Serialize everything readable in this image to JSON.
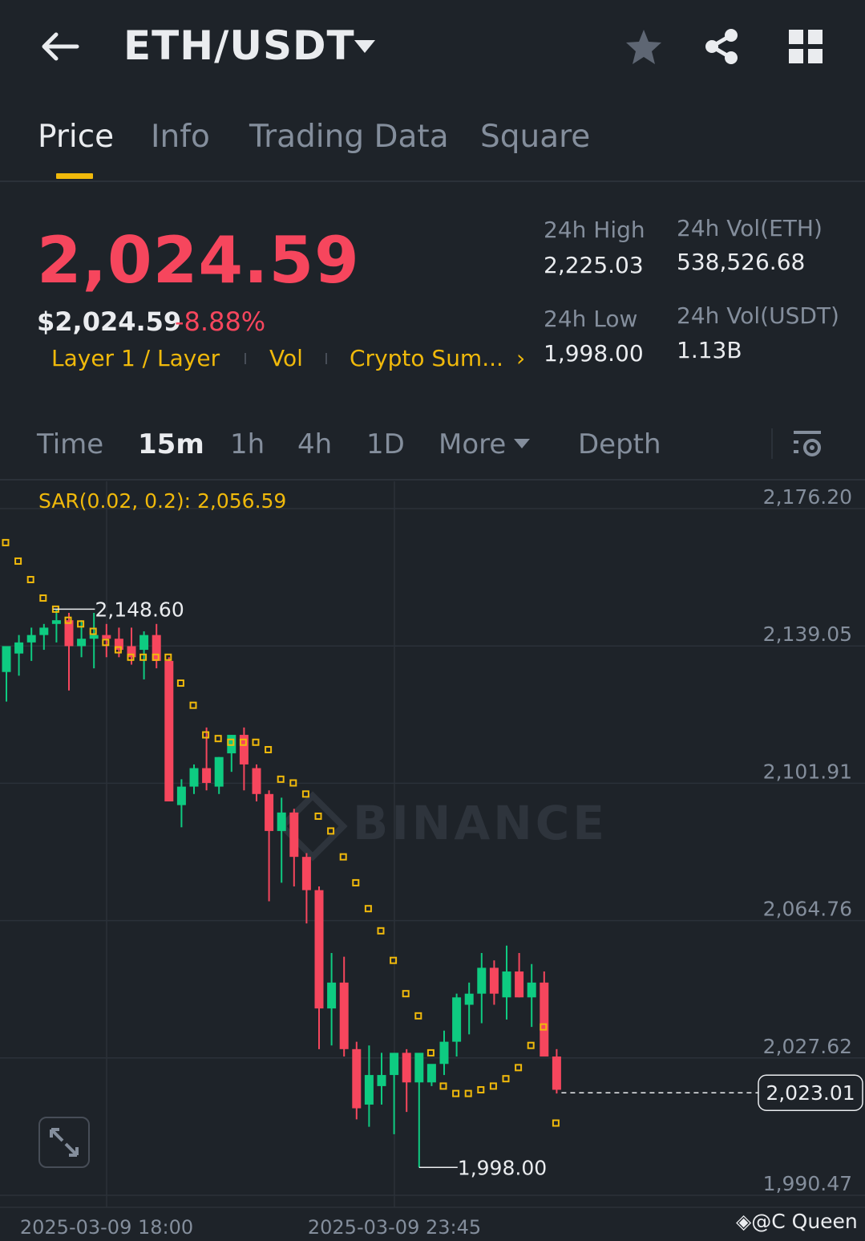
{
  "header": {
    "pair": "ETH/USDT",
    "icons": [
      "back-arrow-icon",
      "caret-down-icon",
      "star-icon",
      "share-icon",
      "grid-icon"
    ]
  },
  "tabs": [
    {
      "label": "Price",
      "active": true
    },
    {
      "label": "Info",
      "active": false
    },
    {
      "label": "Trading Data",
      "active": false
    },
    {
      "label": "Square",
      "active": false
    }
  ],
  "price": {
    "last": "2,024.59",
    "usd": "$2,024.59",
    "change": "-8.88%",
    "tags": [
      "Layer 1 / Layer",
      "Vol",
      "Crypto Sum..."
    ],
    "tags_more": "›"
  },
  "stats": {
    "high_label": "24h High",
    "high": "2,225.03",
    "low_label": "24h Low",
    "low": "1,998.00",
    "vol_eth_label": "24h Vol(ETH)",
    "vol_eth": "538,526.68",
    "vol_usdt_label": "24h Vol(USDT)",
    "vol_usdt": "1.13B"
  },
  "intervals": {
    "items": [
      "Time",
      "15m",
      "1h",
      "4h",
      "1D",
      "More",
      "Depth"
    ],
    "active": "15m"
  },
  "indicator": "SAR(0.02, 0.2): 2,056.59",
  "colors": {
    "up": "#0ecb81",
    "down": "#f6465d",
    "accent": "#f0b90b",
    "bg": "#1e2329",
    "grid": "#2b3139",
    "muted": "#848e9c"
  },
  "chart_data": {
    "type": "candlestick",
    "y_ticks": [
      "2,176.20",
      "2,139.05",
      "2,101.91",
      "2,064.76",
      "2,027.62",
      "1,990.47"
    ],
    "ylim": [
      1990.47,
      2176.2
    ],
    "x_ticks": [
      "2025-03-09 18:00",
      "2025-03-09 23:45"
    ],
    "current_price": "2,023.01",
    "max_label": "2,148.60",
    "min_label": "1,998.00",
    "watermark": "BINANCE",
    "credit": "@C Queen",
    "candles": [
      {
        "o": 2132,
        "h": 2135,
        "l": 2124,
        "c": 2139
      },
      {
        "o": 2137,
        "h": 2142,
        "l": 2131,
        "c": 2140
      },
      {
        "o": 2140,
        "h": 2144,
        "l": 2135,
        "c": 2142
      },
      {
        "o": 2142,
        "h": 2145,
        "l": 2138,
        "c": 2144
      },
      {
        "o": 2145,
        "h": 2149,
        "l": 2140,
        "c": 2146
      },
      {
        "o": 2146,
        "h": 2148,
        "l": 2127,
        "c": 2139
      },
      {
        "o": 2139,
        "h": 2146,
        "l": 2136,
        "c": 2141
      },
      {
        "o": 2141,
        "h": 2148,
        "l": 2133,
        "c": 2142
      },
      {
        "o": 2142,
        "h": 2145,
        "l": 2136,
        "c": 2141
      },
      {
        "o": 2141,
        "h": 2144,
        "l": 2136,
        "c": 2138
      },
      {
        "o": 2139,
        "h": 2144,
        "l": 2134,
        "c": 2136
      },
      {
        "o": 2138,
        "h": 2143,
        "l": 2130,
        "c": 2142
      },
      {
        "o": 2142,
        "h": 2145,
        "l": 2133,
        "c": 2135
      },
      {
        "o": 2135,
        "h": 2136,
        "l": 2098,
        "c": 2097
      },
      {
        "o": 2096,
        "h": 2103,
        "l": 2090,
        "c": 2101
      },
      {
        "o": 2101,
        "h": 2107,
        "l": 2099,
        "c": 2106
      },
      {
        "o": 2106,
        "h": 2117,
        "l": 2100,
        "c": 2102
      },
      {
        "o": 2101,
        "h": 2109,
        "l": 2099,
        "c": 2109
      },
      {
        "o": 2110,
        "h": 2115,
        "l": 2105,
        "c": 2115
      },
      {
        "o": 2115,
        "h": 2117,
        "l": 2100,
        "c": 2107
      },
      {
        "o": 2106,
        "h": 2107,
        "l": 2097,
        "c": 2099
      },
      {
        "o": 2099,
        "h": 2100,
        "l": 2070,
        "c": 2089
      },
      {
        "o": 2089,
        "h": 2098,
        "l": 2075,
        "c": 2094
      },
      {
        "o": 2094,
        "h": 2095,
        "l": 2074,
        "c": 2082
      },
      {
        "o": 2082,
        "h": 2083,
        "l": 2064,
        "c": 2073
      },
      {
        "o": 2073,
        "h": 2074,
        "l": 2030,
        "c": 2041
      },
      {
        "o": 2041,
        "h": 2056,
        "l": 2031,
        "c": 2048
      },
      {
        "o": 2048,
        "h": 2055,
        "l": 2028,
        "c": 2030
      },
      {
        "o": 2030,
        "h": 2032,
        "l": 2011,
        "c": 2014
      },
      {
        "o": 2015,
        "h": 2031,
        "l": 2009,
        "c": 2023
      },
      {
        "o": 2020,
        "h": 2029,
        "l": 2015,
        "c": 2023
      },
      {
        "o": 2023,
        "h": 2027,
        "l": 2007,
        "c": 2029
      },
      {
        "o": 2029,
        "h": 2030,
        "l": 2013,
        "c": 2021
      },
      {
        "o": 2021,
        "h": 2028,
        "l": 1998,
        "c": 2029
      },
      {
        "o": 2021,
        "h": 2025,
        "l": 2020,
        "c": 2026
      },
      {
        "o": 2026,
        "h": 2035,
        "l": 2023,
        "c": 2032
      },
      {
        "o": 2032,
        "h": 2045,
        "l": 2028,
        "c": 2044
      },
      {
        "o": 2042,
        "h": 2048,
        "l": 2034,
        "c": 2045
      },
      {
        "o": 2045,
        "h": 2056,
        "l": 2037,
        "c": 2052
      },
      {
        "o": 2052,
        "h": 2054,
        "l": 2042,
        "c": 2045
      },
      {
        "o": 2044,
        "h": 2058,
        "l": 2038,
        "c": 2051
      },
      {
        "o": 2051,
        "h": 2056,
        "l": 2044,
        "c": 2044
      },
      {
        "o": 2044,
        "h": 2053,
        "l": 2036,
        "c": 2048
      },
      {
        "o": 2048,
        "h": 2051,
        "l": 2041,
        "c": 2028
      },
      {
        "o": 2028,
        "h": 2030,
        "l": 2018,
        "c": 2019
      }
    ],
    "sar": [
      2167,
      2162,
      2157,
      2152,
      2149,
      2146,
      2145,
      2143,
      2140,
      2138,
      2136,
      2136,
      2136,
      2136,
      2129,
      2123,
      2115,
      2114,
      2113,
      2113,
      2113,
      2111,
      2103,
      2102,
      2099,
      2093,
      2089,
      2082,
      2075,
      2068,
      2062,
      2054,
      2045,
      2039,
      2029,
      2020,
      2018,
      2018,
      2019,
      2020,
      2022,
      2025,
      2031,
      2036,
      2010
    ]
  }
}
